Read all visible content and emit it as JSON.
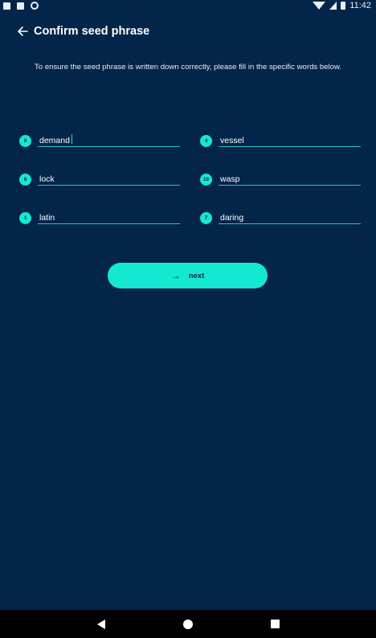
{
  "status": {
    "time": "11:42"
  },
  "header": {
    "title": "Confirm seed phrase"
  },
  "instructions": "To ensure the seed phrase is written down correctly, please fill in the specific words below.",
  "fields": [
    {
      "number": "8",
      "value": "demand"
    },
    {
      "number": "4",
      "value": "vessel"
    },
    {
      "number": "6",
      "value": "lock"
    },
    {
      "number": "10",
      "value": "wasp"
    },
    {
      "number": "1",
      "value": "latin"
    },
    {
      "number": "7",
      "value": "daring"
    }
  ],
  "next_button": {
    "label": "next",
    "icon": "arrow-right-icon"
  },
  "colors": {
    "background": "#03254a",
    "accent": "#14e8d2",
    "underline": "#28c7c7"
  }
}
